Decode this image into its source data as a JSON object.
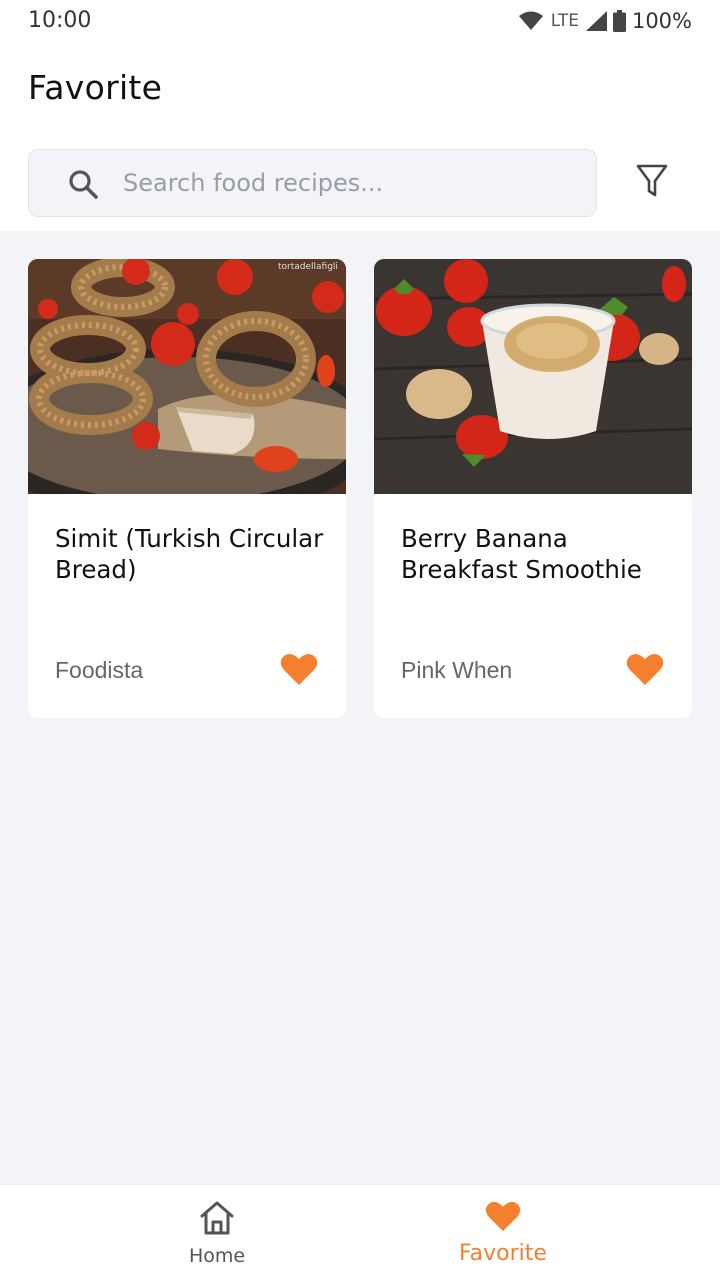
{
  "status_bar": {
    "time": "10:00",
    "network": "LTE",
    "battery": "100%",
    "icons": [
      "wifi-icon",
      "signal-icon",
      "battery-icon"
    ]
  },
  "header": {
    "title": "Favorite"
  },
  "search": {
    "placeholder": "Search food recipes...",
    "value": "",
    "icon": "search-icon",
    "filter_icon": "filter-icon"
  },
  "recipes": [
    {
      "title": "Simit (Turkish Circular Bread)",
      "source": "Foodista",
      "favorited": true,
      "image_watermark": "tortadellafigli"
    },
    {
      "title": "Berry Banana Breakfast Smoothie",
      "source": "Pink When",
      "favorited": true
    }
  ],
  "bottom_nav": {
    "items": [
      {
        "label": "Home",
        "icon": "home-icon",
        "active": false
      },
      {
        "label": "Favorite",
        "icon": "heart-icon",
        "active": true
      }
    ]
  },
  "colors": {
    "accent": "#f47f2e",
    "background": "#f3f4f8",
    "card": "#ffffff"
  }
}
